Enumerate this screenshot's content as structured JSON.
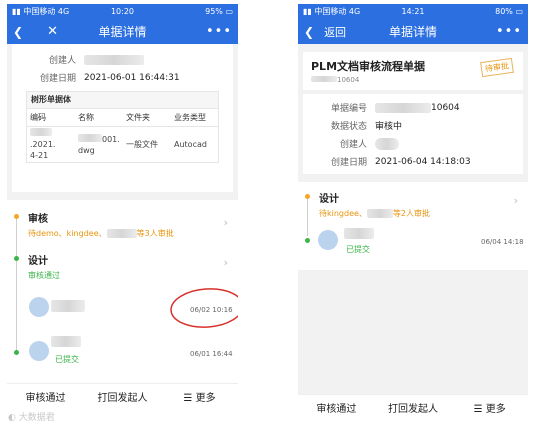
{
  "left": {
    "status": {
      "carrier": "中国移动",
      "network": "4G",
      "time": "10:20",
      "battery": "95%"
    },
    "nav": {
      "title": "单据详情",
      "close": "✕",
      "more": "•••"
    },
    "fields": [
      {
        "label": "创建人",
        "value": ""
      },
      {
        "label": "创建日期",
        "value": "2021-06-01 16:44:31"
      }
    ],
    "table": {
      "caption": "树形单据体",
      "headers": [
        "编码",
        "名称",
        "文件夹",
        "业务类型"
      ],
      "row": {
        "code_line1": ".2021.",
        "code_line2": "4-21",
        "name_line1": "001.",
        "name_line2": "dwg",
        "folder": "一般文件",
        "type": "Autocad"
      }
    },
    "review": {
      "title": "审核",
      "pending": "待demo、kingdee、",
      "pending_suffix": "等3人审批"
    },
    "design": {
      "title": "设计",
      "status": "审核通过",
      "time1": "06/02 10:16",
      "time2": "06/01 16:44",
      "submitted": "已提交"
    },
    "actions": [
      "审核通过",
      "打回发起人",
      "更多"
    ]
  },
  "right": {
    "status": {
      "carrier": "中国移动",
      "network": "4G",
      "time": "14:21",
      "battery": "80%"
    },
    "nav": {
      "back": "返回",
      "title": "单据详情",
      "more": "•••"
    },
    "doc_title": "PLM文档审核流程单据",
    "doc_code": "10604",
    "stamp": "待审批",
    "fields": [
      {
        "label": "单据编号",
        "value": "10604"
      },
      {
        "label": "数据状态",
        "value": "审核中"
      },
      {
        "label": "创建人",
        "value": ""
      },
      {
        "label": "创建日期",
        "value": "2021-06-04 14:18:03"
      }
    ],
    "design": {
      "title": "设计",
      "pending": "待kingdee、",
      "pending_suffix": "等2人审批",
      "submitted": "已提交",
      "time": "06/04 14:18"
    },
    "actions": [
      "审核通过",
      "打回发起人",
      "更多"
    ]
  },
  "watermark": "大数据君"
}
